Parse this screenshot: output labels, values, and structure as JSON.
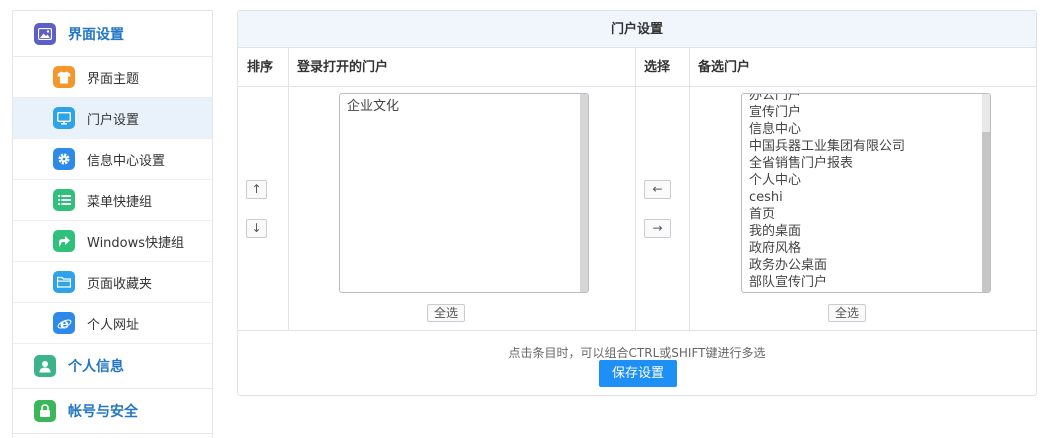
{
  "sidebar": {
    "section1": {
      "label": "界面设置",
      "icon": "picture-icon",
      "color": "#5b5fc7"
    },
    "items": [
      {
        "label": "界面主题",
        "icon": "tshirt-icon",
        "color": "#f5962a"
      },
      {
        "label": "门户设置",
        "icon": "monitor-icon",
        "color": "#2da3e8"
      },
      {
        "label": "信息中心设置",
        "icon": "gear-icon",
        "color": "#2d8ae8"
      },
      {
        "label": "菜单快捷组",
        "icon": "list-icon",
        "color": "#2fc17a"
      },
      {
        "label": "Windows快捷组",
        "icon": "arrow-shortcut-icon",
        "color": "#2fc17a"
      },
      {
        "label": "页面收藏夹",
        "icon": "folder-icon",
        "color": "#2da3e8"
      },
      {
        "label": "个人网址",
        "icon": "ie-browser-icon",
        "color": "#2d8ae8"
      }
    ],
    "section2": {
      "label": "个人信息",
      "icon": "person-icon",
      "color": "#3bb48a"
    },
    "section3": {
      "label": "帐号与安全",
      "icon": "lock-icon",
      "color": "#3bb65a"
    }
  },
  "panel": {
    "title": "门户设置",
    "headers": {
      "sort": "排序",
      "login_portals": "登录打开的门户",
      "select": "选择",
      "available": "备选门户"
    },
    "login_portals": [
      "企业文化"
    ],
    "available_portals": [
      "办公门户",
      "宣传门户",
      "信息中心",
      "中国兵器工业集团有限公司",
      "全省销售门户报表",
      "个人中心",
      "ceshi",
      "首页",
      "我的桌面",
      "政府风格",
      "政务办公桌面",
      "部队宣传门户"
    ],
    "up_arrow": "↑",
    "down_arrow": "↓",
    "left_arrow": "←",
    "right_arrow": "→",
    "select_all_left": "全选",
    "select_all_right": "全选",
    "hint": "点击条目时，可以组合CTRL或SHIFT键进行多选",
    "save_label": "保存设置"
  }
}
